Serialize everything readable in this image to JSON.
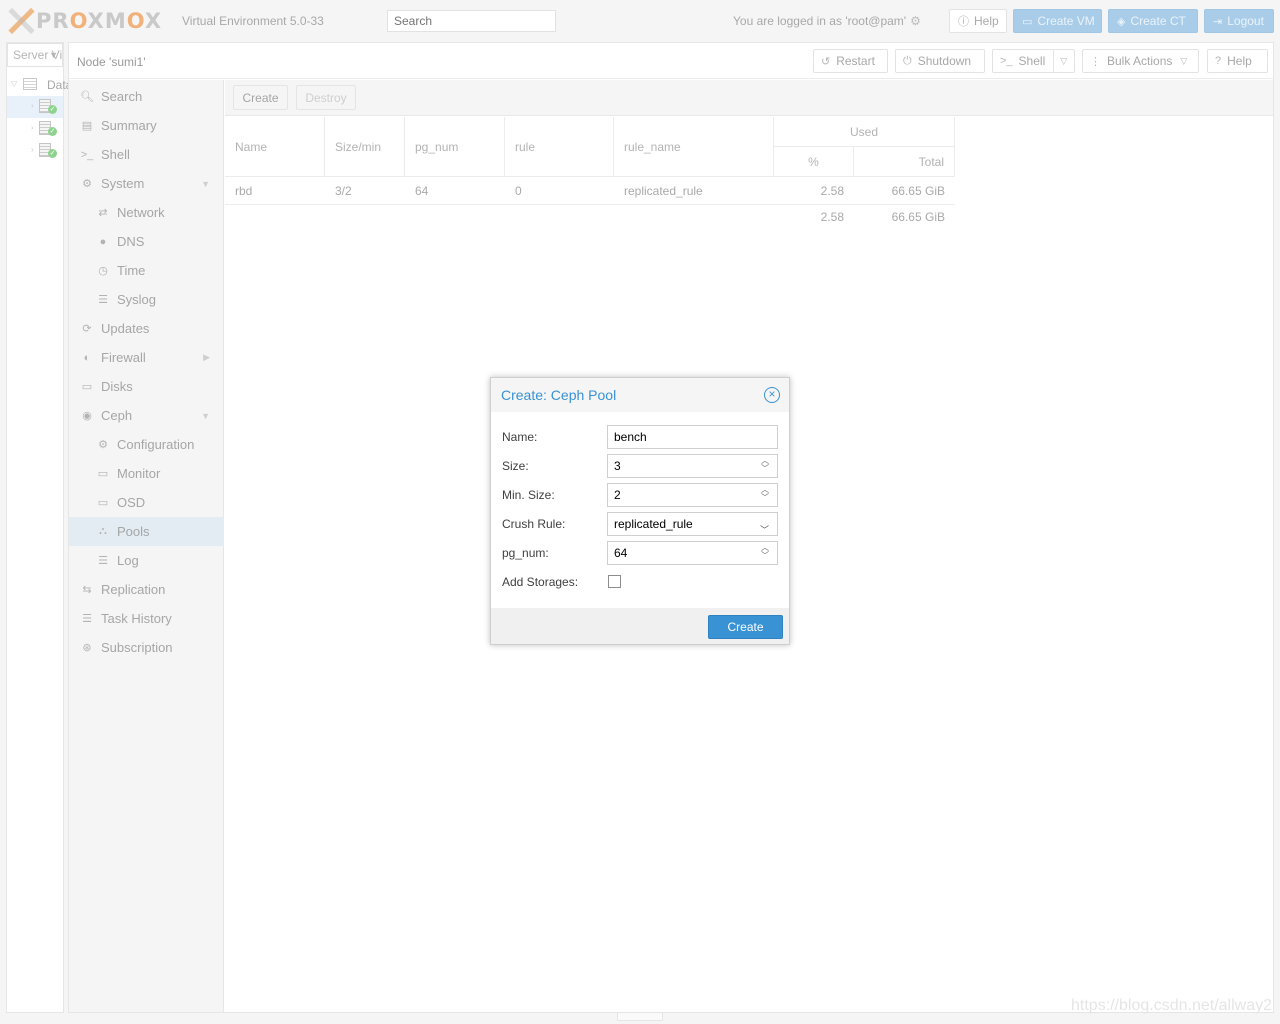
{
  "header": {
    "logo_text_pre": "PR",
    "logo_text_o1": "O",
    "logo_text_mid": "XM",
    "logo_text_o2": "O",
    "logo_text_post": "X",
    "version": "Virtual Environment 5.0-33",
    "search_placeholder": "Search",
    "logged_in": "You are logged in as 'root@pam'",
    "help": "Help",
    "create_vm": "Create VM",
    "create_ct": "Create CT",
    "logout": "Logout"
  },
  "tree": {
    "view_label": "Server View",
    "datacenter_label": "Datacenter"
  },
  "node": {
    "title": "Node 'sumi1'",
    "buttons": {
      "restart": "Restart",
      "shutdown": "Shutdown",
      "shell": "Shell",
      "bulk_actions": "Bulk Actions",
      "help": "Help"
    }
  },
  "nav": {
    "search": "Search",
    "summary": "Summary",
    "shell": "Shell",
    "system": "System",
    "network": "Network",
    "dns": "DNS",
    "time": "Time",
    "syslog": "Syslog",
    "updates": "Updates",
    "firewall": "Firewall",
    "disks": "Disks",
    "ceph": "Ceph",
    "configuration": "Configuration",
    "monitor": "Monitor",
    "osd": "OSD",
    "pools": "Pools",
    "log": "Log",
    "replication": "Replication",
    "task_history": "Task History",
    "subscription": "Subscription"
  },
  "toolbar": {
    "create": "Create",
    "destroy": "Destroy"
  },
  "pool_grid": {
    "columns": {
      "name": "Name",
      "size_min": "Size/min",
      "pg_num": "pg_num",
      "rule": "rule",
      "rule_name": "rule_name",
      "used": "Used",
      "percent": "%",
      "total": "Total"
    },
    "rows": [
      {
        "name": "rbd",
        "size_min": "3/2",
        "pg_num": "64",
        "rule": "0",
        "rule_name": "replicated_rule",
        "percent": "2.58",
        "total": "66.65 GiB"
      }
    ],
    "summary": {
      "percent": "2.58",
      "total": "66.65 GiB"
    }
  },
  "dialog": {
    "title": "Create: Ceph Pool",
    "labels": {
      "name": "Name:",
      "size": "Size:",
      "min_size": "Min. Size:",
      "crush_rule": "Crush Rule:",
      "pg_num": "pg_num:",
      "add_storages": "Add Storages:"
    },
    "values": {
      "name": "bench",
      "size": "3",
      "min_size": "2",
      "crush_rule": "replicated_rule",
      "pg_num": "64",
      "add_storages": false
    },
    "create_button": "Create"
  },
  "watermark": "https://blog.csdn.net/allway2",
  "colors": {
    "accent": "#3892d4",
    "brand_orange": "#e57000",
    "selection": "#e3ebf3"
  }
}
